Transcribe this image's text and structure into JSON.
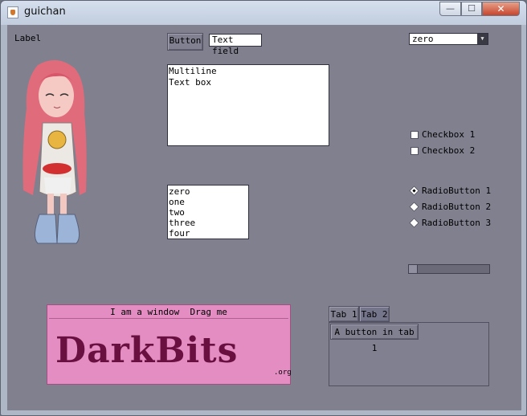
{
  "window": {
    "title": "guichan",
    "minimize_glyph": "—",
    "maximize_glyph": "☐",
    "close_glyph": "✕"
  },
  "label": "Label",
  "button": "Button",
  "text_field": "Text field",
  "text_box_lines": [
    "Multiline",
    "Text box"
  ],
  "dropdown": {
    "selected": "zero",
    "arrow": "▼"
  },
  "list_items": [
    "zero",
    "one",
    "two",
    "three",
    "four"
  ],
  "checkboxes": [
    "Checkbox 1",
    "Checkbox 2"
  ],
  "radios": [
    "RadioButton 1",
    "RadioButton 2",
    "RadioButton 3"
  ],
  "slider_value": 0,
  "inner_window": {
    "title": "I am a window  Drag me",
    "logo_text": "DarkBits",
    "logo_suffix": ".org"
  },
  "tabs": [
    "Tab 1",
    "Tab 2"
  ],
  "tab_button": "A button in tab 1",
  "colors": {
    "background": "#80808f",
    "widget": "#808090",
    "logo_pink": "#e080c0",
    "logo_dark": "#6a1040"
  }
}
